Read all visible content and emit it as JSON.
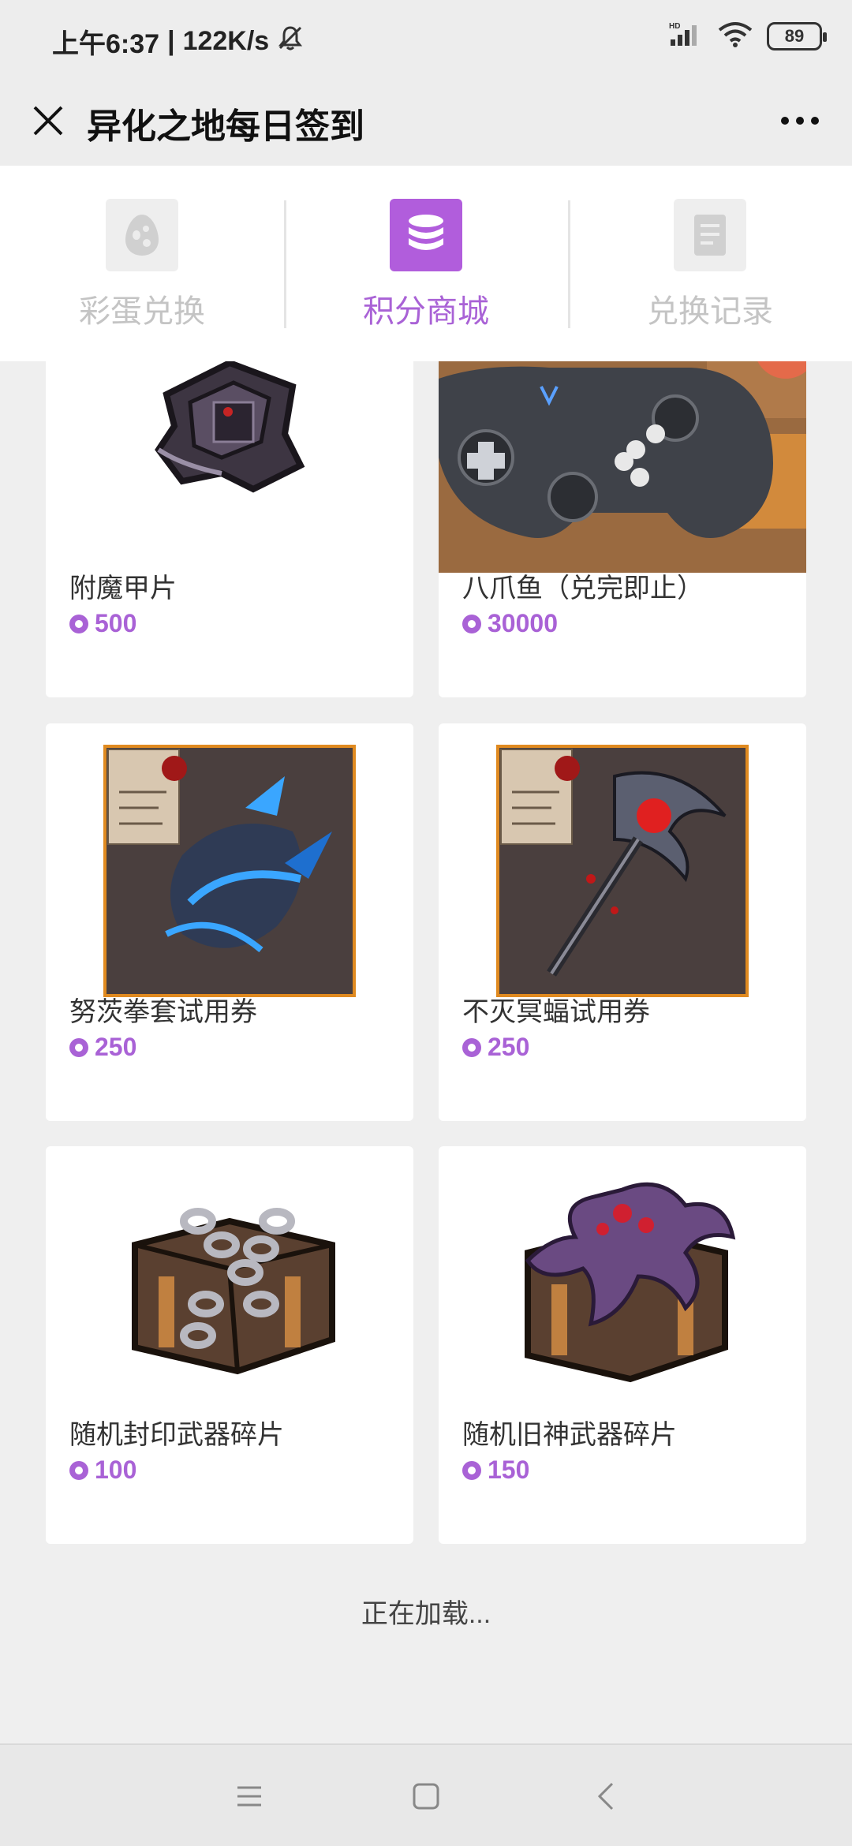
{
  "status_bar": {
    "time": "上午6:37",
    "speed": "122K/s",
    "network": "HD",
    "battery": "89",
    "icons": [
      "mute-icon",
      "signal-icon",
      "wifi-icon",
      "battery-icon"
    ]
  },
  "header": {
    "title": "异化之地每日签到",
    "close_icon": "close-icon",
    "more_icon": "more-icon"
  },
  "tabs": [
    {
      "label": "彩蛋兑换",
      "icon": "egg-icon",
      "active": false
    },
    {
      "label": "积分商城",
      "icon": "coins-stack-icon",
      "active": true
    },
    {
      "label": "兑换记录",
      "icon": "document-icon",
      "active": false
    }
  ],
  "products": [
    {
      "name": "附魔甲片",
      "price": "500",
      "image": "armor-plate-image"
    },
    {
      "name": "八爪鱼（兑完即止）",
      "price": "30000",
      "image": "gamepad-image"
    },
    {
      "name": "努茨拳套试用券",
      "price": "250",
      "image": "gauntlet-coupon-image"
    },
    {
      "name": "不灭冥蝠试用券",
      "price": "250",
      "image": "bat-axe-coupon-image"
    },
    {
      "name": "随机封印武器碎片",
      "price": "100",
      "image": "chained-chest-image"
    },
    {
      "name": "随机旧神武器碎片",
      "price": "150",
      "image": "tentacle-chest-image"
    }
  ],
  "loading_text": "正在加载...",
  "colors": {
    "accent": "#a962d6",
    "tab_inactive": "#c4c4c4",
    "background": "#efefef"
  },
  "nav_bar": {
    "icons": [
      "menu-icon",
      "home-icon",
      "back-icon"
    ]
  }
}
